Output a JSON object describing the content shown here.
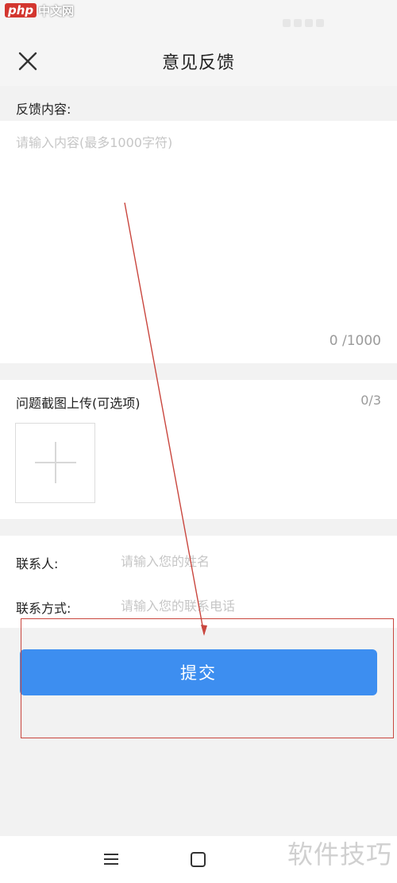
{
  "watermark": {
    "site_logo_text": "php",
    "site_name": "中文网",
    "bottom_text": "软件技巧"
  },
  "header": {
    "title": "意见反馈",
    "close_icon": "close-icon"
  },
  "feedback": {
    "label": "反馈内容:",
    "placeholder": "请输入内容(最多1000字符)",
    "value": "",
    "char_count": "0 /1000"
  },
  "upload": {
    "title": "问题截图上传(可选项)",
    "count": "0/3",
    "add_icon": "plus-icon"
  },
  "contact": {
    "name_label": "联系人:",
    "name_placeholder": "请输入您的姓名",
    "phone_label": "联系方式:",
    "phone_placeholder": "请输入您的联系电话"
  },
  "submit": {
    "label": "提交"
  },
  "bottom_nav": {
    "menu_icon": "menu-icon",
    "home_icon": "home-icon"
  },
  "colors": {
    "accent": "#3d8ef0",
    "annotation": "#c9463e",
    "page_bg": "#f2f2f2"
  }
}
